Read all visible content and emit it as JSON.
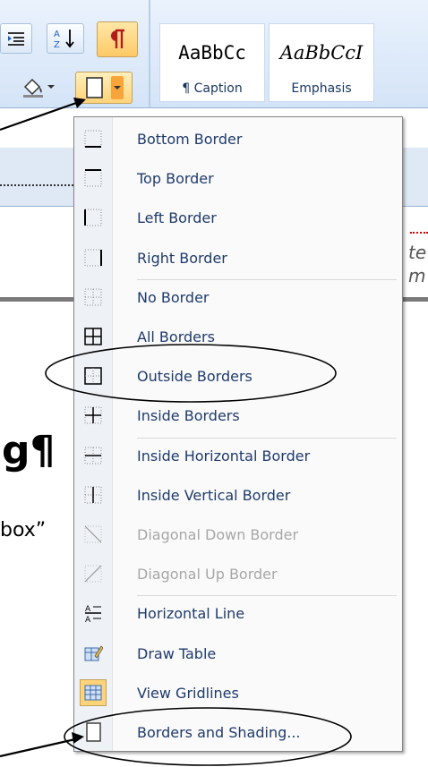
{
  "ribbon": {
    "styles": [
      {
        "sample": "AaBbCc",
        "label": "¶ Caption"
      },
      {
        "sample": "AaBbCcI",
        "label": "Emphasis"
      }
    ]
  },
  "document": {
    "heading_fragment": "g¶",
    "body_fragment": "box”",
    "right_fragment_1": "te",
    "right_fragment_2": "m"
  },
  "border_menu": {
    "items": [
      {
        "label": "Bottom Border",
        "icon": "bottom-border-icon",
        "enabled": true
      },
      {
        "label": "Top Border",
        "icon": "top-border-icon",
        "enabled": true
      },
      {
        "label": "Left Border",
        "icon": "left-border-icon",
        "enabled": true
      },
      {
        "label": "Right Border",
        "icon": "right-border-icon",
        "enabled": true
      },
      {
        "label": "No Border",
        "icon": "no-border-icon",
        "enabled": true
      },
      {
        "label": "All Borders",
        "icon": "all-borders-icon",
        "enabled": true
      },
      {
        "label": "Outside Borders",
        "icon": "outside-borders-icon",
        "enabled": true
      },
      {
        "label": "Inside Borders",
        "icon": "inside-borders-icon",
        "enabled": true
      },
      {
        "label": "Inside Horizontal Border",
        "icon": "inside-horizontal-border-icon",
        "enabled": true
      },
      {
        "label": "Inside Vertical Border",
        "icon": "inside-vertical-border-icon",
        "enabled": true
      },
      {
        "label": "Diagonal Down Border",
        "icon": "diagonal-down-border-icon",
        "enabled": false
      },
      {
        "label": "Diagonal Up Border",
        "icon": "diagonal-up-border-icon",
        "enabled": false
      },
      {
        "label": "Horizontal Line",
        "icon": "horizontal-line-icon",
        "enabled": true
      },
      {
        "label": "Draw Table",
        "icon": "draw-table-icon",
        "enabled": true
      },
      {
        "label": "View Gridlines",
        "icon": "view-gridlines-icon",
        "enabled": true
      },
      {
        "label": "Borders and Shading...",
        "icon": "borders-and-shading-icon",
        "enabled": true
      }
    ]
  },
  "colors": {
    "menu_text": "#1f3b6b",
    "disabled_text": "#a7a7a7",
    "ribbon_bg": "#dbe7f8",
    "highlight": "#ffc966"
  }
}
